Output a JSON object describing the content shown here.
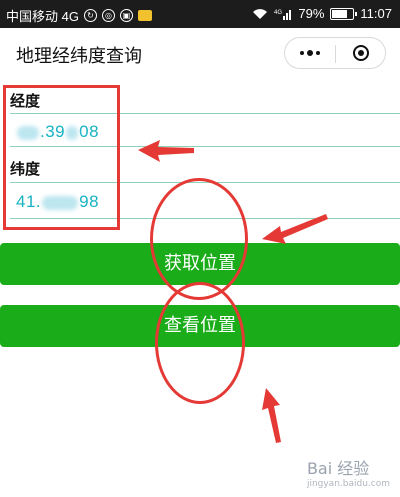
{
  "status_bar": {
    "carrier": "中国移动 4G",
    "network_label": "4G",
    "battery": "79%",
    "battery_level": 0.79,
    "time": "11:07"
  },
  "nav": {
    "title": "地理经纬度查询"
  },
  "form": {
    "longitude_label": "经度",
    "longitude_value_prefix": "",
    "longitude_value_suffix": ".39",
    "longitude_value_end": "08",
    "latitude_label": "纬度",
    "latitude_value_prefix": "41.",
    "latitude_value_end": "98"
  },
  "buttons": {
    "get_location": "获取位置",
    "view_location": "查看位置"
  },
  "annotations": {
    "color": "#e53935"
  },
  "watermark": {
    "text": "Bai 经验",
    "sub": "jingyan.baidu.com"
  },
  "colors": {
    "accent_green": "#1aad19",
    "value_teal": "#17b3c3",
    "field_line": "#8fd0b8"
  }
}
